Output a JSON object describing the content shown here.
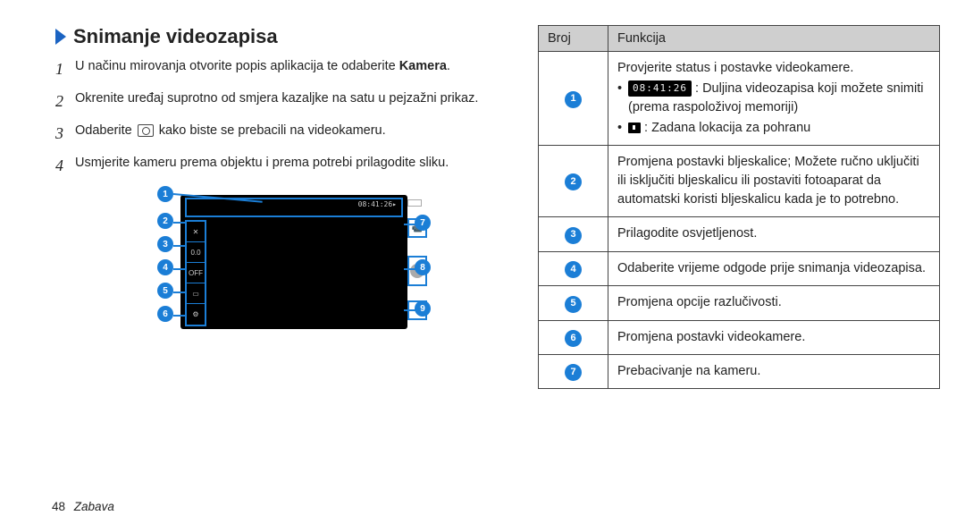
{
  "section_title": "Snimanje videozapisa",
  "steps": [
    {
      "n": "1",
      "html": "U načinu mirovanja otvorite popis aplikacija te odaberite <b>Kamera</b>."
    },
    {
      "n": "2",
      "html": "Okrenite uređaj suprotno od smjera kazaljke na satu u pejzažni prikaz."
    },
    {
      "n": "3",
      "html": "Odaberite <span class=\"camera-icon-inline\" data-name=\"camera-icon\" data-interactable=\"false\"></span> kako biste se prebacili na videokameru."
    },
    {
      "n": "4",
      "html": "Usmjerite kameru prema objektu i prema potrebi prilagodite sliku."
    }
  ],
  "viewfinder": {
    "time_display": "08:41:26▸",
    "left_icons": [
      "✕",
      "0.0",
      "OFF",
      "▭",
      "⚙"
    ]
  },
  "callouts": {
    "c1": "1",
    "c2": "2",
    "c3": "3",
    "c4": "4",
    "c5": "5",
    "c6": "6",
    "c7": "7",
    "c8": "8",
    "c9": "9"
  },
  "table": {
    "head_num": "Broj",
    "head_func": "Funkcija",
    "rows": [
      {
        "n": "1",
        "lead": "Provjerite status i postavke videokamere.",
        "bullets": [
          {
            "prefix_icon": "time",
            "prefix_text": "08:41:26",
            "text": " : Duljina videozapisa koji možete snimiti (prema raspoloživoj memoriji)"
          },
          {
            "prefix_icon": "store",
            "text": " : Zadana lokacija za pohranu"
          }
        ]
      },
      {
        "n": "2",
        "text": "Promjena postavki bljeskalice; Možete ručno uključiti ili isključiti bljeskalicu ili postaviti fotoaparat da automatski koristi bljeskalicu kada je to potrebno."
      },
      {
        "n": "3",
        "text": "Prilagodite osvjetljenost."
      },
      {
        "n": "4",
        "text": "Odaberite vrijeme odgode prije snimanja videozapisa."
      },
      {
        "n": "5",
        "text": "Promjena opcije razlučivosti."
      },
      {
        "n": "6",
        "text": "Promjena postavki videokamere."
      },
      {
        "n": "7",
        "text": "Prebacivanje na kameru."
      }
    ]
  },
  "footer": {
    "page": "48",
    "section": "Zabava"
  }
}
